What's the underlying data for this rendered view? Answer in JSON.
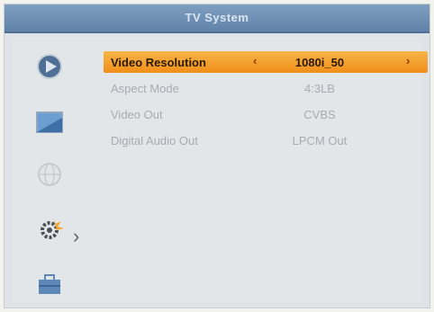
{
  "window": {
    "title": "TV System"
  },
  "sidebar": {
    "icons": [
      {
        "name": "play-icon"
      },
      {
        "name": "picture-icon"
      },
      {
        "name": "globe-icon"
      },
      {
        "name": "settings-gear-icon"
      },
      {
        "name": "toolbox-icon"
      }
    ],
    "active_index": 3
  },
  "settings": {
    "rows": [
      {
        "label": "Video Resolution",
        "value": "1080i_50",
        "selected": true
      },
      {
        "label": "Aspect Mode",
        "value": "4:3LB",
        "selected": false
      },
      {
        "label": "Video Out",
        "value": "CVBS",
        "selected": false
      },
      {
        "label": "Digital Audio Out",
        "value": "LPCM Out",
        "selected": false
      }
    ],
    "arrow_left": "‹",
    "arrow_right": "›"
  },
  "colors": {
    "highlight": "#f5a230",
    "titlebar": "#6f8fb3",
    "inactive_text": "#a7acb2",
    "background": "#e3e6e9"
  }
}
